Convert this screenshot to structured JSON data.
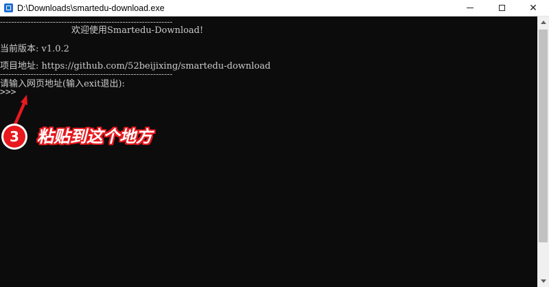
{
  "window": {
    "title": "D:\\Downloads\\smartedu-download.exe",
    "minimize_glyph": "",
    "maximize_glyph": "",
    "close_glyph": "✕"
  },
  "console": {
    "separator": "--------------------------------------------------------------",
    "welcome": "欢迎使用Smartedu-Download!",
    "version": "当前版本: v1.0.2",
    "project": "项目地址: https://github.com/52beijixing/smartedu-download",
    "input_prompt": "请输入网页地址(输入exit退出):",
    "cursor_prompt": ">>>"
  },
  "annotation": {
    "step_number": "3",
    "text": "粘贴到这个地方",
    "color": "#e8191e"
  },
  "icons": {
    "app": "console-app-icon",
    "minimize": "minimize-icon",
    "maximize": "maximize-icon",
    "close": "close-icon",
    "arrow": "red-arrow-icon"
  }
}
